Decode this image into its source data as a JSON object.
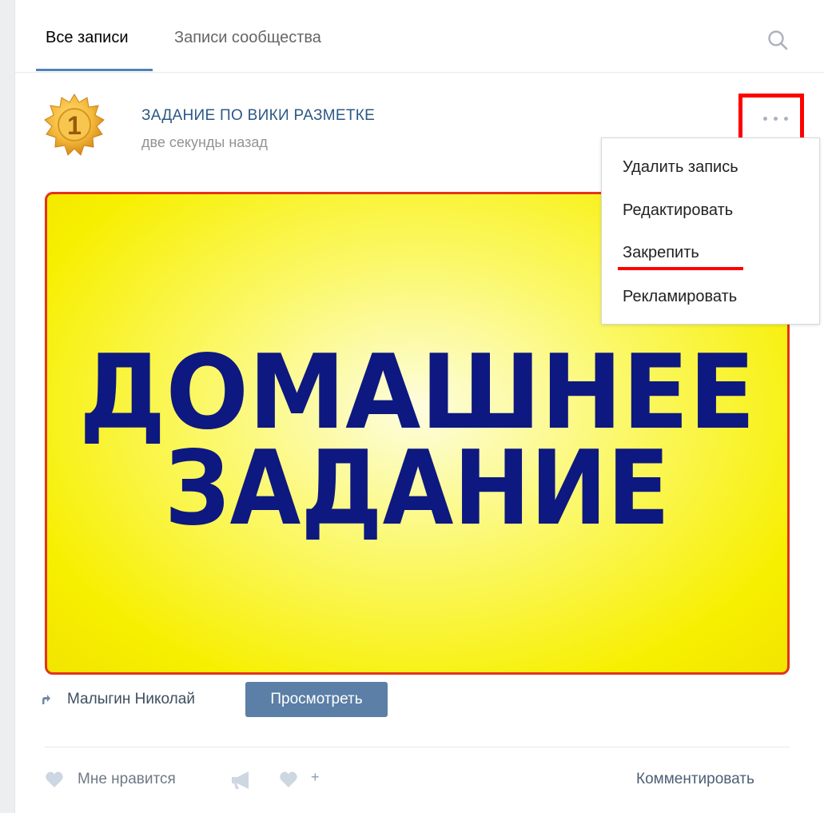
{
  "tabs": {
    "all_posts": "Все записи",
    "community_posts": "Записи сообщества"
  },
  "post": {
    "title": "ЗАДАНИЕ ПО ВИКИ РАЗМЕТКЕ",
    "time": "две секунды назад",
    "avatar_badge": "1",
    "image_text": {
      "line1": "ДОМАШНЕЕ",
      "line2": "ЗАДАНИЕ"
    },
    "author": "Малыгин Николай",
    "view_button": "Просмотреть"
  },
  "menu": {
    "items": [
      "Удалить запись",
      "Редактировать",
      "Закрепить",
      "Рекламировать"
    ]
  },
  "actions": {
    "like": "Мне нравится",
    "subscribe_plus": "+",
    "comment": "Комментировать"
  },
  "colors": {
    "accent": "#5181b8",
    "link": "#2a5885",
    "highlight": "#ff0000",
    "image_text": "#0d1880",
    "image_bg": "#f7ef00"
  }
}
